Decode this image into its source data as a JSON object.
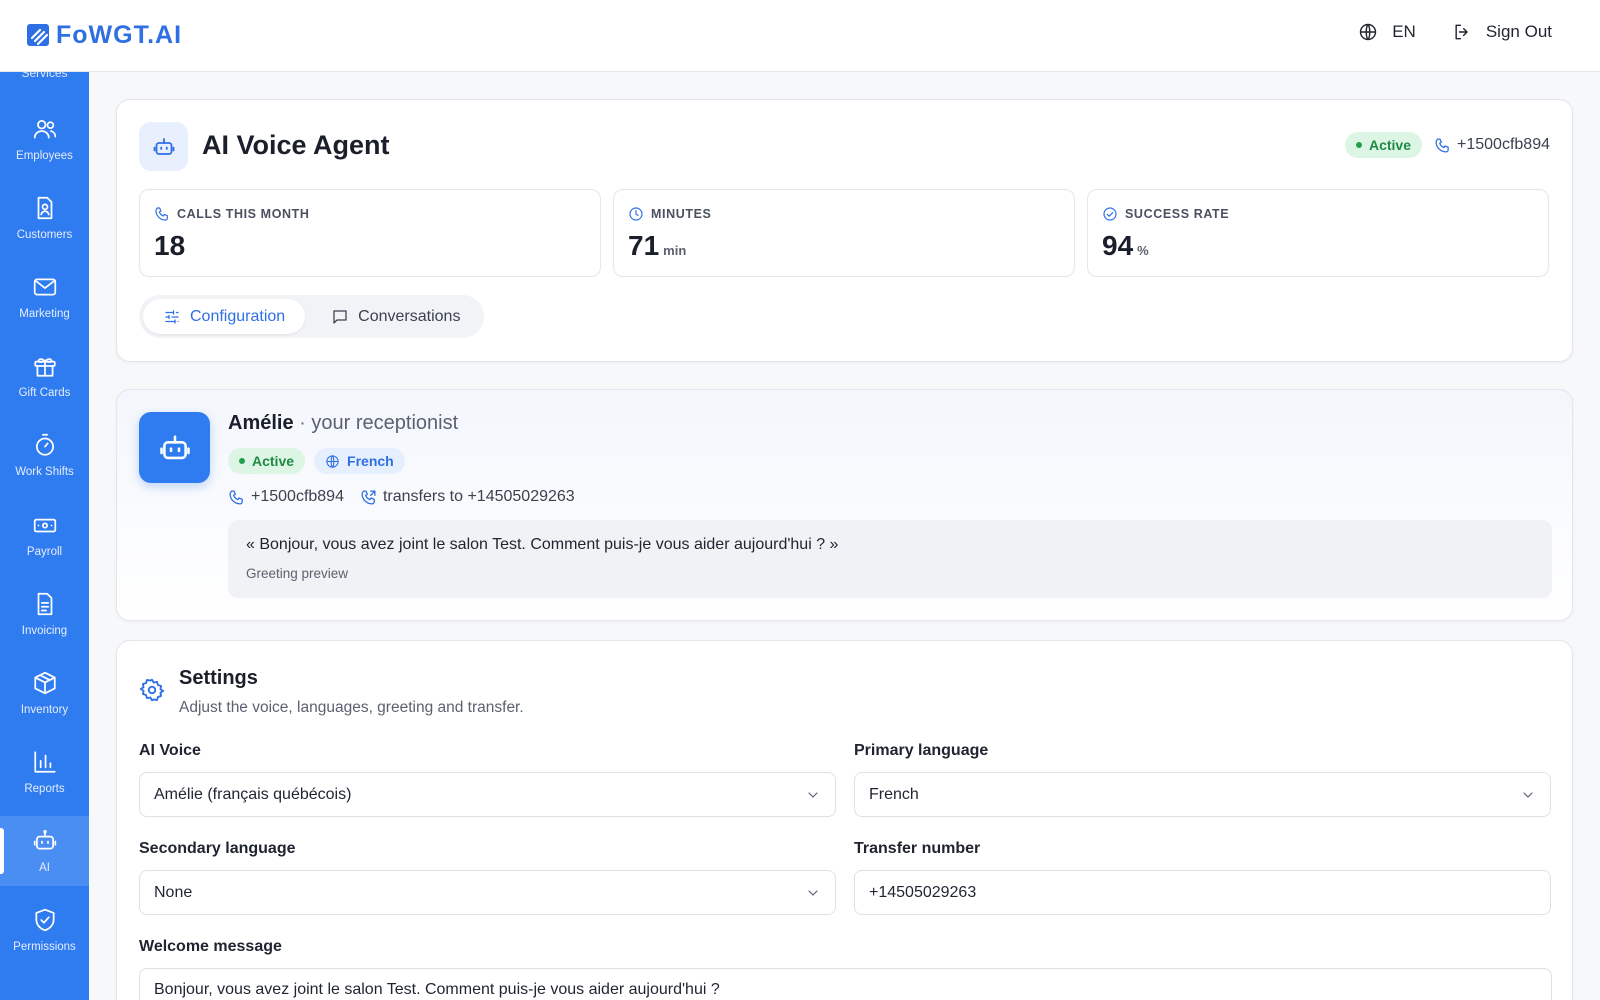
{
  "app": {
    "logo_text": "FoWGT.AI",
    "language": "EN",
    "sign_out": "Sign Out",
    "brand_color": "#2f7bf0"
  },
  "sidebar": {
    "cut_label": "Services",
    "items": [
      {
        "label": "Employees",
        "icon": "users-icon"
      },
      {
        "label": "Customers",
        "icon": "customer-card-icon"
      },
      {
        "label": "Marketing",
        "icon": "mail-icon"
      },
      {
        "label": "Gift Cards",
        "icon": "gift-icon"
      },
      {
        "label": "Work Shifts",
        "icon": "stopwatch-icon"
      },
      {
        "label": "Payroll",
        "icon": "banknote-icon"
      },
      {
        "label": "Invoicing",
        "icon": "document-icon"
      },
      {
        "label": "Inventory",
        "icon": "box-icon"
      },
      {
        "label": "Reports",
        "icon": "bar-chart-icon"
      },
      {
        "label": "AI",
        "icon": "robot-icon",
        "active": true
      },
      {
        "label": "Permissions",
        "icon": "shield-check-icon"
      }
    ]
  },
  "header": {
    "title": "AI Voice Agent",
    "status": "Active",
    "phone": "+1500cfb894",
    "stats": [
      {
        "label": "CALLS THIS MONTH",
        "value": "18",
        "unit": ""
      },
      {
        "label": "MINUTES",
        "value": "71",
        "unit": "min"
      },
      {
        "label": "SUCCESS RATE",
        "value": "94",
        "unit": "%"
      }
    ],
    "tabs": [
      {
        "label": "Configuration",
        "active": true
      },
      {
        "label": "Conversations",
        "active": false
      }
    ]
  },
  "agent": {
    "name": "Amélie",
    "separator": "·",
    "role": "your receptionist",
    "status": "Active",
    "language": "French",
    "phone": "+1500cfb894",
    "transfer": "transfers to +14505029263",
    "greeting": "« Bonjour, vous avez joint le salon Test. Comment puis-je vous aider aujourd'hui ? »",
    "greeting_label": "Greeting preview"
  },
  "settings": {
    "title": "Settings",
    "subtitle": "Adjust the voice, languages, greeting and transfer.",
    "ai_voice_label": "AI Voice",
    "ai_voice_value": "Amélie (français québécois)",
    "primary_language_label": "Primary language",
    "primary_language_value": "French",
    "secondary_language_label": "Secondary language",
    "secondary_language_value": "None",
    "transfer_number_label": "Transfer number",
    "transfer_number_value": "+14505029263",
    "welcome_label": "Welcome message",
    "welcome_value": "Bonjour, vous avez joint le salon Test. Comment puis-je vous aider aujourd'hui ?"
  }
}
